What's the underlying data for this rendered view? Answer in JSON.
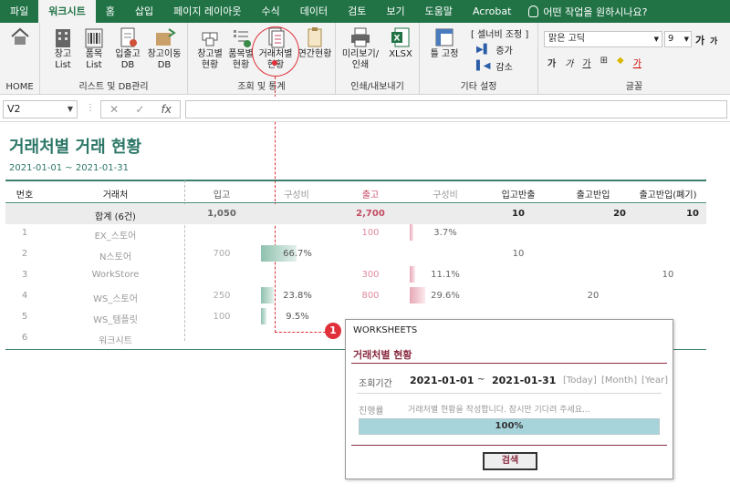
{
  "tabs": [
    "파일",
    "워크시트",
    "홈",
    "삽입",
    "페이지 레이아웃",
    "수식",
    "데이터",
    "검토",
    "보기",
    "도움말",
    "Acrobat"
  ],
  "tell_me": "어떤 작업을 원하시나요?",
  "ribbon": {
    "home_group": "HOME",
    "list_db_group": "리스트 및 DB관리",
    "buttons_list": [
      {
        "l1": "창고",
        "l2": "List"
      },
      {
        "l1": "품목",
        "l2": "List"
      },
      {
        "l1": "입출고",
        "l2": "DB"
      },
      {
        "l1": "창고이동",
        "l2": "DB"
      }
    ],
    "query_group": "조회 및 통계",
    "buttons_query": [
      {
        "l1": "창고별",
        "l2": "현황"
      },
      {
        "l1": "품목별",
        "l2": "현황"
      },
      {
        "l1": "거래처별",
        "l2": "현황"
      },
      {
        "l1": "연간현황",
        "l2": ""
      }
    ],
    "print_group": "인쇄/내보내기",
    "print_btn": {
      "l1": "미리보기/",
      "l2": "인쇄"
    },
    "xlsx_btn": "XLSX",
    "etc_group": "기타 설정",
    "freeze_btn": {
      "l1": "틀 고정",
      "l2": ""
    },
    "cell_width": "[ 셀너비 조정 ]",
    "increase": "증가",
    "decrease": "감소",
    "font_group": "글꼴",
    "font_name": "맑은 고딕",
    "font_size": "9",
    "font_grow": "가",
    "font_shrink": "가"
  },
  "formula_bar": {
    "name_box": "V2",
    "fx": "fx"
  },
  "sheet": {
    "title": "거래처별 거래 현황",
    "period": "2021-01-01 ~ 2021-01-31",
    "headers": [
      "번호",
      "거래처",
      "입고",
      "구성비",
      "출고",
      "구성비",
      "입고반출",
      "출고반입",
      "출고반입(폐기)"
    ],
    "total": {
      "label": "합계 (6건)",
      "in": "1,050",
      "out": "2,700",
      "in_ret": "10",
      "out_ret": "20",
      "out_ret_disc": "10"
    },
    "rows": [
      {
        "no": "1",
        "name": "EX_스토어",
        "in": "",
        "in_pct": "",
        "out": "100",
        "out_pct": "3.7%",
        "in_ret": "",
        "out_ret": "",
        "disc": ""
      },
      {
        "no": "2",
        "name": "N스토어",
        "in": "700",
        "in_pct": "66.7%",
        "out": "",
        "out_pct": "",
        "in_ret": "10",
        "out_ret": "",
        "disc": ""
      },
      {
        "no": "3",
        "name": "WorkStore",
        "in": "",
        "in_pct": "",
        "out": "300",
        "out_pct": "11.1%",
        "in_ret": "",
        "out_ret": "",
        "disc": "10"
      },
      {
        "no": "4",
        "name": "WS_스토어",
        "in": "250",
        "in_pct": "23.8%",
        "out": "800",
        "out_pct": "29.6%",
        "in_ret": "",
        "out_ret": "20",
        "disc": ""
      },
      {
        "no": "5",
        "name": "WS_템플릿",
        "in": "100",
        "in_pct": "9.5%",
        "out": "",
        "out_pct": "",
        "in_ret": "",
        "out_ret": "",
        "disc": ""
      },
      {
        "no": "6",
        "name": "워크시트",
        "in": "",
        "in_pct": "",
        "out": "",
        "out_pct": "",
        "in_ret": "",
        "out_ret": "",
        "disc": ""
      }
    ]
  },
  "dialog": {
    "badge": "1",
    "title": "WORKSHEETS",
    "subtitle": "거래처별 현황",
    "period_label": "조회기간",
    "start": "2021-01-01",
    "tilde": "~",
    "end": "2021-01-31",
    "today": "[Today]",
    "month": "[Month]",
    "year": "[Year]",
    "progress_label": "진행률",
    "progress_msg": "거래처별 현황을 작성합니다. 잠시만 기다려 주세요...",
    "progress_value": "100%",
    "progress_fraction": 1.0,
    "search": "검색"
  }
}
